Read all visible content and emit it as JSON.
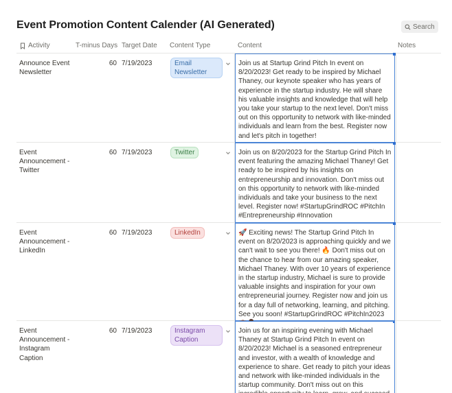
{
  "page": {
    "title": "Event Promotion Content Calender (AI Generated)"
  },
  "search": {
    "label": "Search"
  },
  "columns": {
    "activity": "Activity",
    "tminus": "T-minus Days",
    "date": "Target Date",
    "type": "Content Type",
    "content": "Content",
    "notes": "Notes"
  },
  "rows": [
    {
      "activity": "Announce Event Newsletter",
      "tminus": "60",
      "date": "7/19/2023",
      "type": "Email Newsletter",
      "content": "Join us at Startup Grind Pitch In event on 8/20/2023! Get ready to be inspired by Michael Thaney, our keynote speaker who has years of experience in the startup industry. He will share his valuable insights and knowledge that will help you take your startup to the next level. Don't miss out on this opportunity to network with like-minded individuals and learn from the best. Register now and let's pitch in together!",
      "notes": ""
    },
    {
      "activity": "Event Announcement - Twitter",
      "tminus": "60",
      "date": "7/19/2023",
      "type": "Twitter",
      "content": "Join us on 8/20/2023 for the Startup Grind Pitch In event featuring the amazing Michael Thaney! Get ready to be inspired by his insights on entrepreneurship and innovation. Don't miss out on this opportunity to network with like-minded individuals and take your business to the next level. Register now! #StartupGrindROC #PitchIn #Entrepreneurship #Innovation",
      "notes": ""
    },
    {
      "activity": "Event Announcement - LinkedIn",
      "tminus": "60",
      "date": "7/19/2023",
      "type": "LinkedIn",
      "content": "🚀 Exciting news! The Startup Grind Pitch In event on 8/20/2023 is approaching quickly and we can't wait to see you there! 🔥 Don't miss out on the chance to hear from our amazing speaker, Michael Thaney. With over 10 years of experience in the startup industry, Michael is sure to provide valuable insights and inspiration for your own entrepreneurial journey. Register now and join us for a day full of networking, learning, and pitching. See you soon! #StartupGrindROC #PitchIn2023 💼👨‍💼",
      "notes": ""
    },
    {
      "activity": "Event Announcement - Instagram Caption",
      "tminus": "60",
      "date": "7/19/2023",
      "type": "Instagram Caption",
      "content": "Join us for an inspiring evening with Michael Thaney at Startup Grind Pitch In event on 8/20/2023! Michael is a seasoned entrepreneur and investor, with a wealth of knowledge and experience to share. Get ready to pitch your ideas and network with like-minded individuals in the startup community. Don't miss out on this incredible opportunity to learn, grow, and succeed. See you there!",
      "notes": ""
    }
  ],
  "colors": {
    "email_tag": "#dbe9fb",
    "twitter_tag": "#dff3e2",
    "linkedin_tag": "#fbe0df",
    "instagram_tag": "#ece1f7",
    "selection": "#4a84d6"
  }
}
